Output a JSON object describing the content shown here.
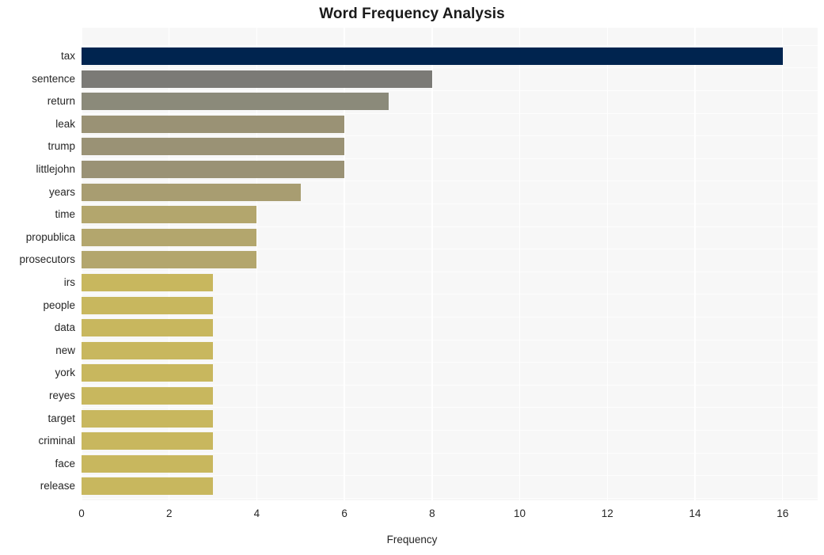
{
  "chart_data": {
    "type": "bar",
    "orientation": "horizontal",
    "title": "Word Frequency Analysis",
    "xlabel": "Frequency",
    "ylabel": "",
    "categories": [
      "tax",
      "sentence",
      "return",
      "leak",
      "trump",
      "littlejohn",
      "years",
      "time",
      "propublica",
      "prosecutors",
      "irs",
      "people",
      "data",
      "new",
      "york",
      "reyes",
      "target",
      "criminal",
      "face",
      "release"
    ],
    "values": [
      16,
      8,
      7,
      6,
      6,
      6,
      5,
      4,
      4,
      4,
      3,
      3,
      3,
      3,
      3,
      3,
      3,
      3,
      3,
      3
    ],
    "bar_colors": [
      "#00244f",
      "#7b7a76",
      "#8b8a7a",
      "#9a9275",
      "#9a9275",
      "#9a9275",
      "#a89d71",
      "#b3a66d",
      "#b3a66d",
      "#b3a66d",
      "#c8b75e",
      "#c8b75e",
      "#c8b75e",
      "#c8b75e",
      "#c8b75e",
      "#c8b75e",
      "#c8b75e",
      "#c8b75e",
      "#c8b75e",
      "#c8b75e"
    ],
    "xlim": [
      0,
      16.8
    ],
    "xticks": [
      0,
      2,
      4,
      6,
      8,
      10,
      12,
      14,
      16
    ],
    "xtick_labels": [
      "0",
      "2",
      "4",
      "6",
      "8",
      "10",
      "12",
      "14",
      "16"
    ],
    "grid": true,
    "grid_color": "#ffffff",
    "plot_background": "#f7f7f7",
    "figure_background": "#ffffff",
    "legend": null,
    "legend_position": "none",
    "tick_color": "#262626",
    "title_color": "#1a1a1a"
  }
}
